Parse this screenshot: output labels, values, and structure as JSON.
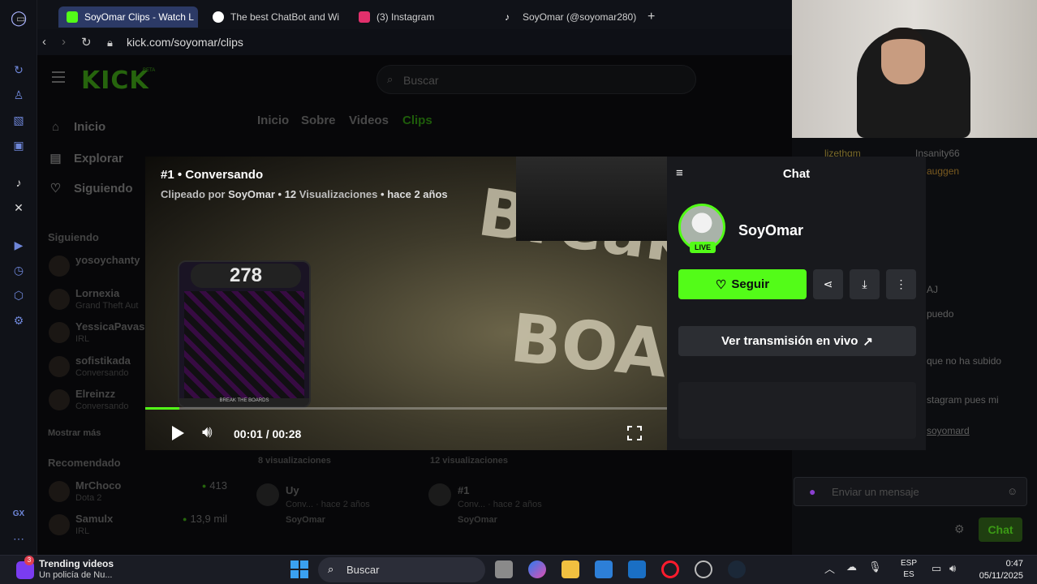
{
  "browser": {
    "tabs": [
      {
        "label": "SoyOmar Clips - Watch L",
        "color": "#53fc18"
      },
      {
        "label": "The best ChatBot and Wi",
        "color": "#ffffff"
      },
      {
        "label": "(3) Instagram",
        "color": "#e1306c"
      },
      {
        "label": "SoyOmar (@soyomar280)",
        "color": "#111111"
      }
    ],
    "new_tab": "+",
    "url": "kick.com/soyomar/clips"
  },
  "kick": {
    "logo": "KICK",
    "beta": "BETA",
    "search_placeholder": "Buscar",
    "nav": [
      {
        "label": "Inicio",
        "icon": "home-icon"
      },
      {
        "label": "Explorar",
        "icon": "browse-icon"
      },
      {
        "label": "Siguiendo",
        "icon": "heart-icon"
      }
    ],
    "following_title": "Siguiendo",
    "following": [
      {
        "name": "yosoychanty",
        "sub": ""
      },
      {
        "name": "Lornexia",
        "sub": "Grand Theft Aut"
      },
      {
        "name": "YessicaPavas",
        "sub": "IRL"
      },
      {
        "name": "sofistikada",
        "sub": "Conversando"
      },
      {
        "name": "Elreinzz",
        "sub": "Conversando"
      }
    ],
    "show_more": "Mostrar más",
    "recommended_title": "Recomendado",
    "recommended": [
      {
        "name": "MrChoco",
        "sub": "Dota 2",
        "viewers": "413"
      },
      {
        "name": "Samulx",
        "sub": "IRL",
        "viewers": "13,9 mil"
      }
    ],
    "channel_tabs": [
      "Inicio",
      "Sobre",
      "Videos",
      "Clips"
    ],
    "active_channel_tab": 3,
    "clips_below": [
      {
        "views": "8 visualizaciones",
        "title": "Uy",
        "meta": "Conv... · hace 2 años",
        "author": "SoyOmar"
      },
      {
        "views": "12 visualizaciones",
        "title": "#1",
        "meta": "Conv... · hace 2 años",
        "author": "SoyOmar"
      }
    ]
  },
  "modal": {
    "title": "#1 • Conversando",
    "meta_prefix": "Clipeado por",
    "meta_author": "SoyOmar",
    "meta_sep1": "•",
    "meta_views_num": "12",
    "meta_views_label": "Visualizaciones",
    "meta_sep2": "•",
    "meta_time": "hace 2 años",
    "game_score": "278",
    "game_label": "BREAK THE BOARDS",
    "bg_word_1": "Break",
    "bg_word_2": "BOAR",
    "time": "00:01 / 00:28",
    "progress": 0.065,
    "panel_title": "Chat",
    "streamer": "SoyOmar",
    "live": "LIVE",
    "follow": "Seguir",
    "watch_live": "Ver transmisión en vivo"
  },
  "chat": {
    "users": [
      "lizethgm",
      "Insanity66",
      "auggen"
    ],
    "lines": [
      "AJ",
      "puedo",
      "que no ha subido",
      "stagram pues mi",
      "soyomard"
    ],
    "input_placeholder": "Enviar un mensaje",
    "send": "Chat"
  },
  "taskbar": {
    "notif_count": "3",
    "trend_title": "Trending videos",
    "trend_sub": "Un policía de Nu...",
    "search": "Buscar",
    "lang1": "ESP",
    "lang2": "ES",
    "time": "0:47",
    "date": "05/11/2025"
  },
  "colors": {
    "kick_green": "#53fc18",
    "opera_red": "#ff1b2d"
  }
}
